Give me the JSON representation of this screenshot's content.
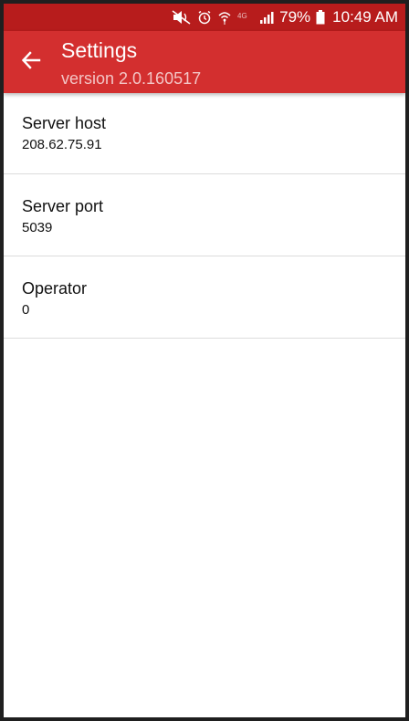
{
  "status_bar": {
    "battery_percent": "79%",
    "time": "10:49 AM",
    "network_label": "4G",
    "icons": [
      "mute-icon",
      "alarm-icon",
      "wifi-icon",
      "network-4g-icon",
      "signal-icon",
      "battery-icon"
    ]
  },
  "app_bar": {
    "title": "Settings",
    "subtitle": "version 2.0.160517",
    "back_icon": "arrow-back-icon"
  },
  "settings": [
    {
      "title": "Server host",
      "value": "208.62.75.91"
    },
    {
      "title": "Server port",
      "value": "5039"
    },
    {
      "title": "Operator",
      "value": "0"
    }
  ],
  "colors": {
    "status_bar": "#b71c1c",
    "app_bar": "#d32f2f",
    "background": "#ffffff",
    "divider": "#dcdcdc"
  }
}
